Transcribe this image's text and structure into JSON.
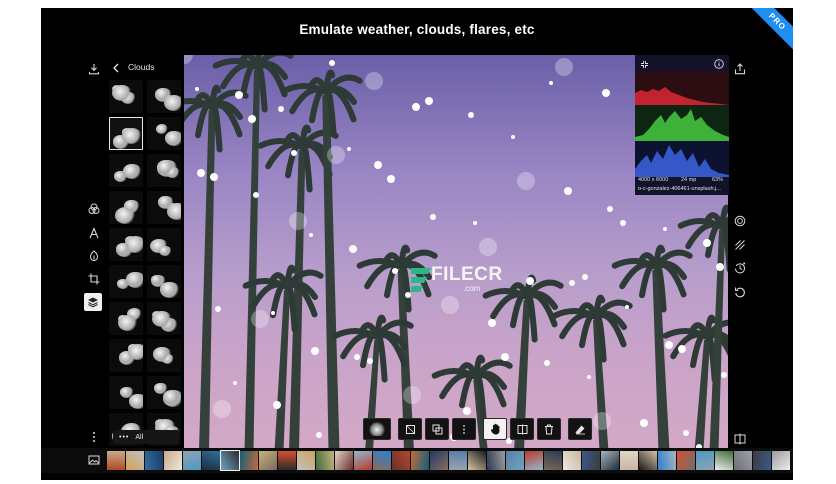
{
  "banner": {
    "title": "Emulate weather, clouds, flares, etc",
    "badge": "PRO"
  },
  "panel": {
    "title": "Clouds",
    "all_label": "All",
    "thumb_count": 20,
    "selected_index": 2
  },
  "left_tools": [
    {
      "icon": "download-icon"
    },
    {
      "icon": "filters-icon"
    },
    {
      "icon": "text-icon"
    },
    {
      "icon": "retouch-icon"
    },
    {
      "icon": "crop-icon"
    },
    {
      "icon": "layers-icon",
      "active": true
    },
    {
      "icon": "more-vertical-icon"
    }
  ],
  "right_tools": [
    {
      "icon": "share-icon"
    },
    {
      "icon": "mask-icon"
    },
    {
      "icon": "compare-slash-icon"
    },
    {
      "icon": "history-icon"
    },
    {
      "icon": "undo-icon"
    },
    {
      "icon": "split-view-icon"
    }
  ],
  "histogram": {
    "dimensions": "4000 x 6000",
    "megapixels": "24 mp",
    "zoom": "63%",
    "filename": "o-c-gonzalez-406461-unsplash.j..."
  },
  "watermark": {
    "brand": "FILECR",
    "suffix": ".com"
  },
  "toolbar": [
    {
      "icon": "cloud-thumb-icon"
    },
    {
      "icon": "transform-icon"
    },
    {
      "icon": "duplicate-icon"
    },
    {
      "icon": "more-vertical-icon"
    },
    {
      "icon": "hand-icon",
      "active": true
    },
    {
      "icon": "flip-icon"
    },
    {
      "icon": "trash-icon"
    },
    {
      "icon": "eraser-icon"
    }
  ],
  "filmstrip": {
    "icon": "gallery-icon",
    "selected_index": 6,
    "count": 36
  },
  "colors": {
    "accent": "#1f8ef1",
    "background": "#000000"
  }
}
